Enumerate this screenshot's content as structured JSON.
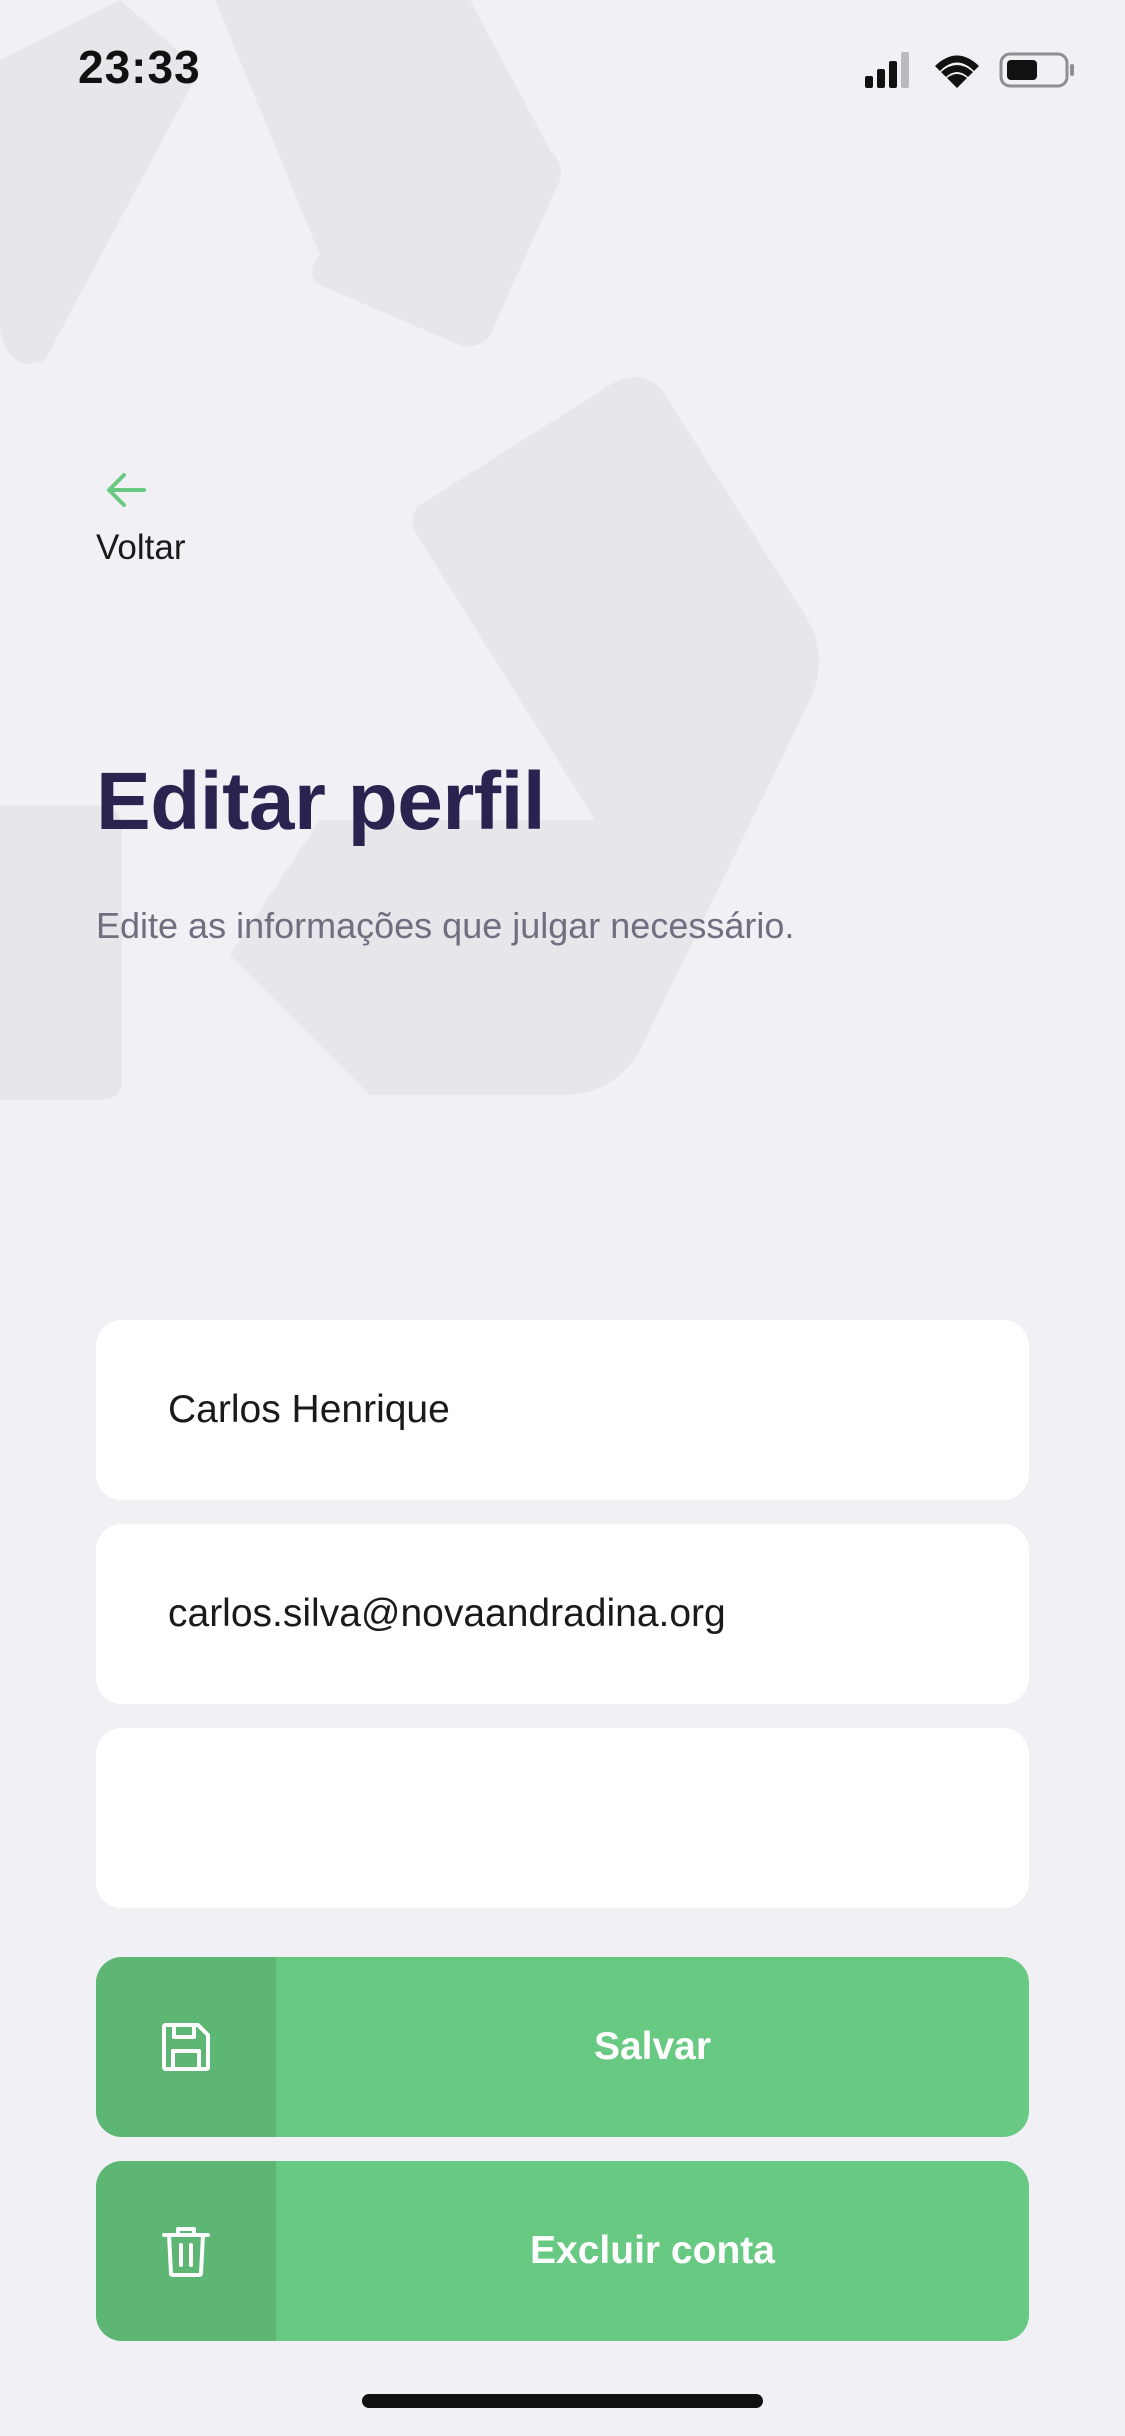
{
  "status_bar": {
    "time": "23:33",
    "icons": [
      "cellular-signal-icon",
      "wifi-icon",
      "battery-icon"
    ]
  },
  "header": {
    "back_label": "Voltar",
    "back_icon": "arrow-left-icon"
  },
  "main": {
    "title": "Editar perfil",
    "subtitle": "Edite as informações que julgar necessário."
  },
  "form": {
    "name_value": "Carlos Henrique",
    "email_value": "carlos.silva@novaandradina.org",
    "third_value": ""
  },
  "actions": {
    "save_label": "Salvar",
    "save_icon": "floppy-disk-icon",
    "delete_label": "Excluir conta",
    "delete_icon": "trash-icon"
  },
  "colors": {
    "background": "#F0F0F5",
    "accent": "#68C982",
    "accent_dark": "#5DB674",
    "title": "#2A2350",
    "subtitle": "#6F6F80"
  }
}
